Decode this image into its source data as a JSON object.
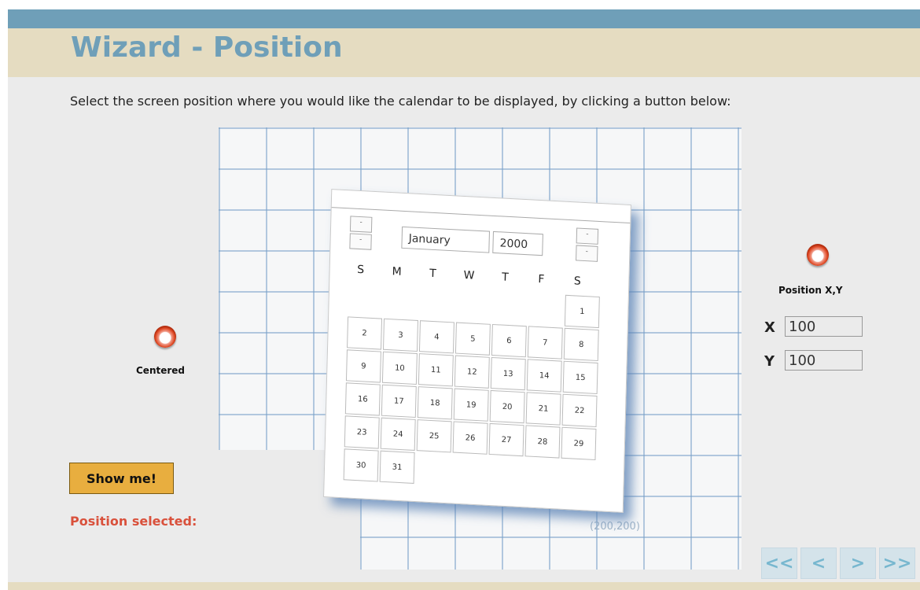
{
  "header": {
    "title": "Wizard - Position"
  },
  "instruction": "Select the screen position where you would like the calendar to be displayed, by clicking a button below:",
  "illustration": {
    "calendar": {
      "month": "January",
      "year": "2000",
      "spin_up": "-",
      "spin_down": "-",
      "days_of_week": [
        "S",
        "M",
        "T",
        "W",
        "T",
        "F",
        "S"
      ],
      "days": [
        "1",
        "2",
        "3",
        "4",
        "5",
        "6",
        "7",
        "8",
        "9",
        "10",
        "11",
        "12",
        "13",
        "14",
        "15",
        "16",
        "17",
        "18",
        "19",
        "20",
        "21",
        "22",
        "23",
        "24",
        "25",
        "26",
        "27",
        "28",
        "29",
        "30",
        "31"
      ]
    },
    "coordinate_label": "(200,200)"
  },
  "options": {
    "centered_label": "Centered",
    "position_xy_label": "Position X,Y",
    "x_label": "X",
    "y_label": "Y",
    "x_value": "100",
    "y_value": "100"
  },
  "actions": {
    "show_me_label": "Show me!",
    "position_selected_label": "Position selected:"
  },
  "navigation": {
    "first_label": "<<",
    "prev_label": "<",
    "next_label": ">",
    "last_label": ">>"
  },
  "colors": {
    "accent": "#6f9fb8",
    "header_bg": "#e5dcc1",
    "button_bg": "#e8ae3f",
    "alert_text": "#d9513c",
    "radio": "#e04a26"
  }
}
